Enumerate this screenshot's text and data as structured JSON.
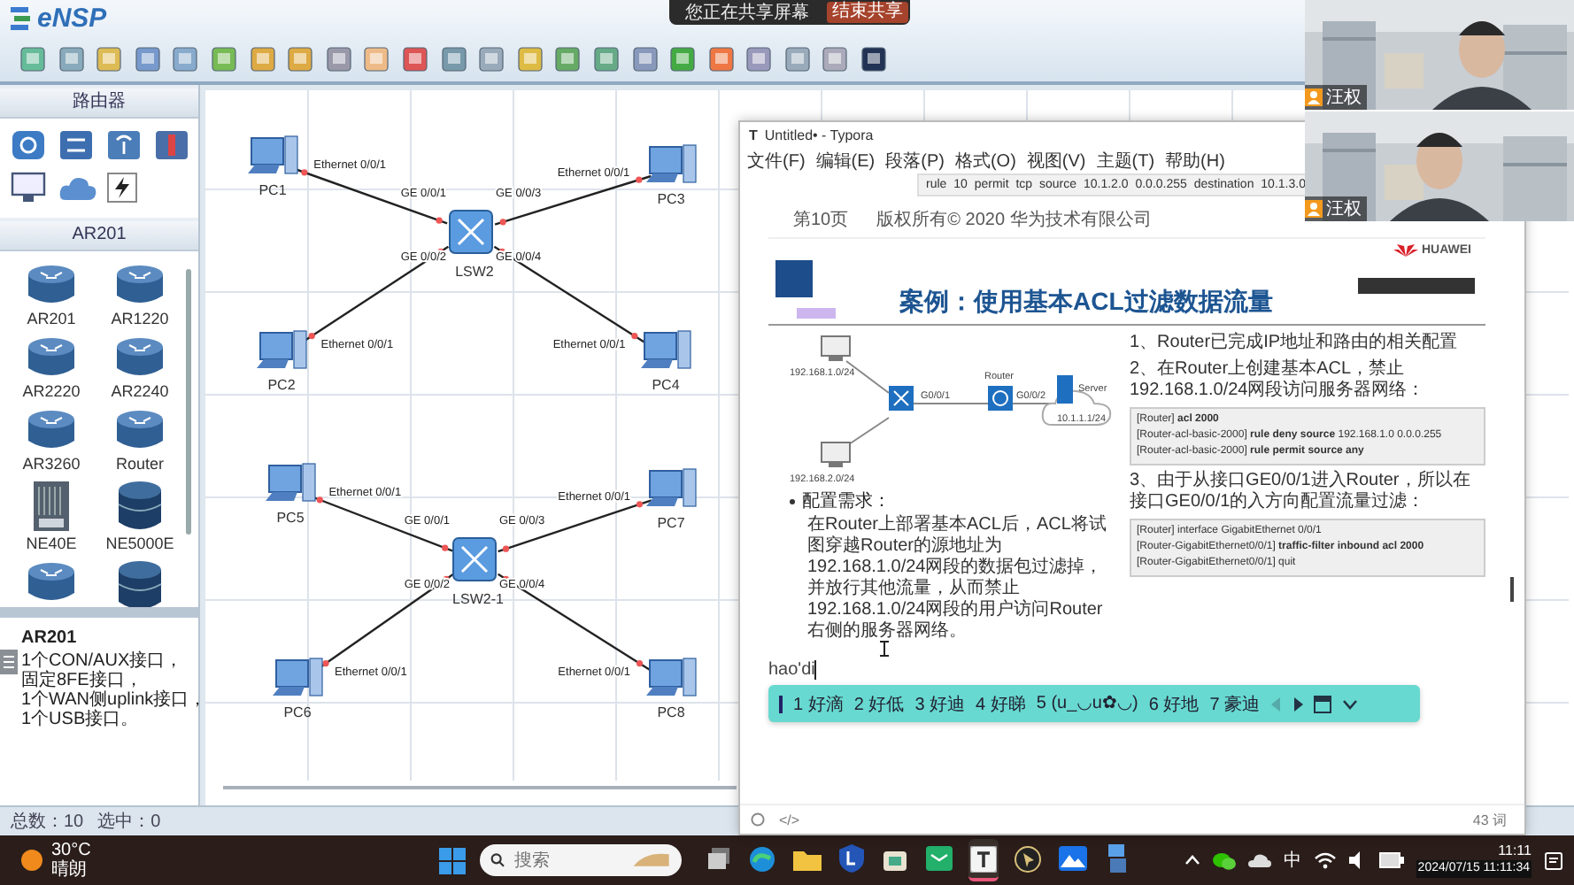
{
  "screen_share": {
    "status": "您正在共享屏幕",
    "stop_button": "结束共享"
  },
  "ensp": {
    "title": "eNSP",
    "palette": {
      "category": "路由器",
      "group": "AR201",
      "devices": [
        {
          "label": "AR201",
          "kind": "router"
        },
        {
          "label": "AR1220",
          "kind": "router"
        },
        {
          "label": "AR2220",
          "kind": "router"
        },
        {
          "label": "AR2240",
          "kind": "router"
        },
        {
          "label": "AR3260",
          "kind": "router"
        },
        {
          "label": "Router",
          "kind": "router"
        },
        {
          "label": "NE40E",
          "kind": "chassis"
        },
        {
          "label": "NE5000E",
          "kind": "core"
        },
        {
          "kind": "router"
        },
        {
          "kind": "core"
        }
      ],
      "info": {
        "title": "AR201",
        "lines": [
          "1个CON/AUX接口，",
          "固定8FE接口，",
          "1个WAN侧uplink接口，",
          "1个USB接口。"
        ]
      }
    },
    "topology": {
      "nodes": [
        {
          "label": "PC1",
          "kind": "pc"
        },
        {
          "label": "LSW2",
          "kind": "switch"
        },
        {
          "label": "PC3",
          "kind": "pc"
        },
        {
          "label": "PC2",
          "kind": "pc"
        },
        {
          "label": "PC4",
          "kind": "pc"
        },
        {
          "label": "PC5",
          "kind": "pc"
        },
        {
          "label": "LSW2-1",
          "kind": "switch"
        },
        {
          "label": "PC7",
          "kind": "pc"
        },
        {
          "label": "PC6",
          "kind": "pc"
        },
        {
          "label": "PC8",
          "kind": "pc"
        }
      ],
      "links": [
        {
          "from_port": "Ethernet 0/0/1",
          "to_port": "GE 0/0/1"
        },
        {
          "from_port": "Ethernet 0/0/1",
          "to_port": "GE 0/0/3"
        },
        {
          "from_port": "Ethernet 0/0/1",
          "to_port": "GE 0/0/2"
        },
        {
          "from_port": "Ethernet 0/0/1",
          "to_port": "GE 0/0/4"
        },
        {
          "from_port": "Ethernet 0/0/1",
          "to_port": "GE 0/0/1"
        },
        {
          "from_port": "Ethernet 0/0/1",
          "to_port": "GE 0/0/3"
        },
        {
          "from_port": "Ethernet 0/0/1",
          "to_port": "GE 0/0/2"
        },
        {
          "from_port": "Ethernet 0/0/1",
          "to_port": "GE 0/0/4"
        }
      ]
    },
    "status_bar": {
      "total": "总数：10",
      "selected": "选中：0"
    }
  },
  "typora": {
    "app_icon": "T",
    "title": "Untitled• - Typora",
    "menu": [
      "文件(F)",
      "编辑(E)",
      "段落(P)",
      "格式(O)",
      "视图(V)",
      "主题(T)",
      "帮助(H)"
    ],
    "document": {
      "code_line": "rule 10 permit tcp source 10.1.2.0 0.0.0.255 destination 10.1.3.0",
      "page_number": "第10页",
      "copyright": "版权所有© 2020 华为技术有限公司",
      "brand": "HUAWEI",
      "slide_title": "案例：使用基本ACL过滤数据流量",
      "diagram": {
        "host_a": "192.168.1.0/24",
        "host_b": "192.168.2.0/24",
        "router": "Router",
        "port_in": "G0/0/1",
        "port_out": "G0/0/2",
        "server": "Server",
        "server_ip": "10.1.1.1/24"
      },
      "requirement_title": "配置需求：",
      "requirement": "在Router上部署基本ACL后，ACL将试图穿越Router的源地址为192.168.1.0/24网段的数据包过滤掉，并放行其他流量，从而禁止192.168.1.0/24网段的用户访问Router右侧的服务器网络。",
      "steps": [
        {
          "text": "1、Router已完成IP地址和路由的相关配置"
        },
        {
          "text": "2、在Router上创建基本ACL，禁止192.168.1.0/24网段访问服务器网络：",
          "code": [
            "[Router] **acl 2000**",
            "[Router-acl-basic-2000] **rule deny source** 192.168.1.0 0.0.0.255",
            "[Router-acl-basic-2000] **rule permit source any**"
          ]
        },
        {
          "text": "3、由于从接口GE0/0/1进入Router，所以在接口GE0/0/1的入方向配置流量过滤：",
          "code": [
            "[Router] interface GigabitEthernet 0/0/1",
            "[Router-GigabitEthernet0/0/1] **traffic-filter inbound acl 2000**",
            "[Router-GigabitEthernet0/0/1] quit"
          ]
        }
      ],
      "typed": "hao'di",
      "candidates": [
        "1 好滴",
        "2 好低",
        "3 好迪",
        "4 好睇",
        "5 (u_◡u✿◡)",
        "6 好地",
        "7 豪迪"
      ]
    },
    "source_toggle": "</>",
    "word_count": "43 词"
  },
  "video_tiles": [
    {
      "name": "汪权"
    },
    {
      "name": "汪权"
    }
  ],
  "taskbar": {
    "temperature": "30°C",
    "weather": "晴朗",
    "search": {
      "placeholder": "搜索"
    },
    "apps": [
      {
        "kind": "taskview",
        "active": false
      },
      {
        "kind": "browser",
        "active": false
      },
      {
        "kind": "folder",
        "active": false
      },
      {
        "kind": "shield",
        "active": false
      },
      {
        "kind": "store",
        "active": false
      },
      {
        "kind": "mail",
        "active": false
      },
      {
        "kind": "editor",
        "active": true
      },
      {
        "kind": "cursor",
        "active": false
      },
      {
        "kind": "mountain",
        "active": false
      },
      {
        "kind": "files",
        "active": false
      }
    ],
    "ime": "中",
    "time": "11:11",
    "timestamp": "2024/07/15 11:11:34"
  }
}
